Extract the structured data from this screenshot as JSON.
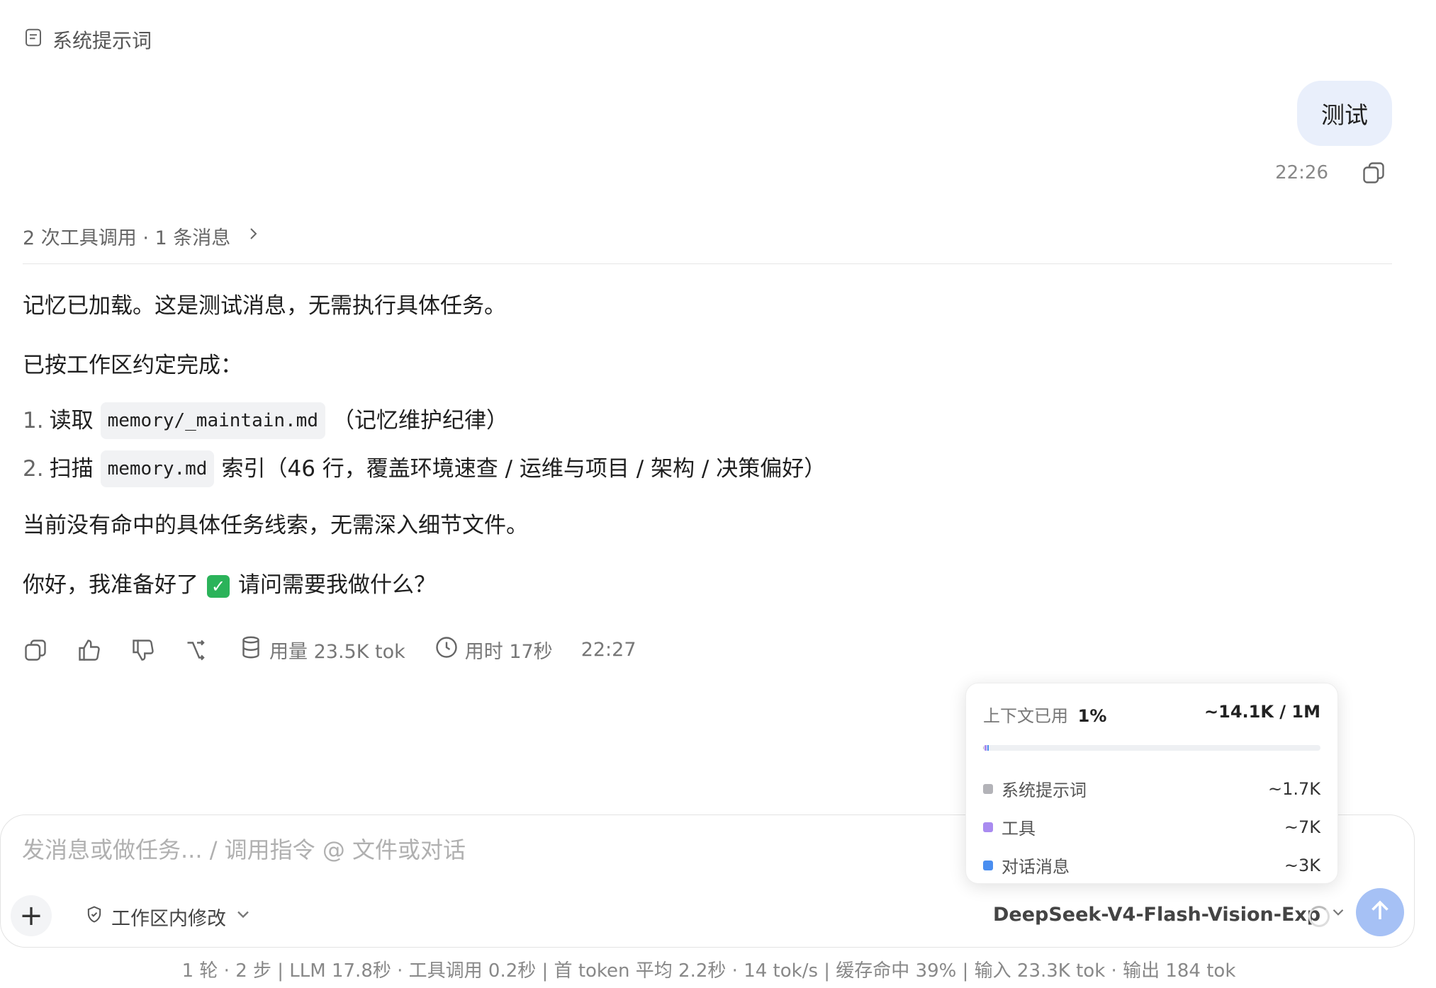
{
  "system_prompt_label": "系统提示词",
  "user_message": {
    "text": "测试",
    "time": "22:26"
  },
  "tool_summary": "2 次工具调用 · 1 条消息",
  "assistant": {
    "p1": "记忆已加载。这是测试消息，无需执行具体任务。",
    "p2": "已按工作区约定完成：",
    "list": [
      {
        "num": "1.",
        "pre": "读取",
        "code": "memory/_maintain.md",
        "post": "（记忆维护纪律）"
      },
      {
        "num": "2.",
        "pre": "扫描",
        "code": "memory.md",
        "post": "索引（46 行，覆盖环境速查 / 运维与项目 / 架构 / 决策偏好）"
      }
    ],
    "p3": "当前没有命中的具体任务线索，无需深入细节文件。",
    "p4_pre": "你好，我准备好了",
    "p4_post": "请问需要我做什么？"
  },
  "actions": {
    "usage": "用量 23.5K tok",
    "duration": "用时 17秒",
    "time": "22:27"
  },
  "context_popover": {
    "label": "上下文已用",
    "percent": "1%",
    "total": "~14.1K / 1M",
    "rows": [
      {
        "name": "系统提示词",
        "value": "~1.7K",
        "color": "#b3b3b8",
        "fraction": 0.0017
      },
      {
        "name": "工具",
        "value": "~7K",
        "color": "#a98bf0",
        "fraction": 0.007
      },
      {
        "name": "对话消息",
        "value": "~3K",
        "color": "#4a8ef0",
        "fraction": 0.003
      }
    ]
  },
  "composer": {
    "placeholder": "发消息或做任务... / 调用指令 @ 文件或对话",
    "mode": "工作区内修改",
    "model": "DeepSeek-V4-Flash-Vision-Exp"
  },
  "footer_stats": "1 轮 · 2 步  |  LLM 17.8秒 · 工具调用 0.2秒  |  首 token 平均 2.2秒 · 14 tok/s  |  缓存命中 39%  |  输入 23.3K tok · 输出 184 tok"
}
